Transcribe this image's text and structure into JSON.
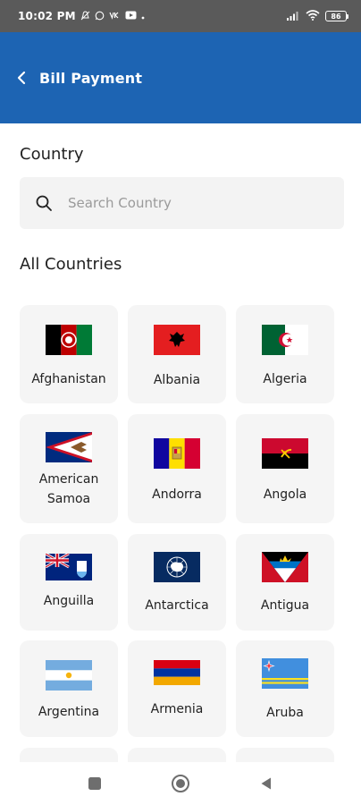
{
  "status_bar": {
    "time": "10:02 PM",
    "battery": "86"
  },
  "app_bar": {
    "title": "Bill Payment"
  },
  "country_section": {
    "label": "Country"
  },
  "search": {
    "placeholder": "Search Country",
    "value": ""
  },
  "all_countries": {
    "label": "All Countries",
    "items": [
      {
        "name": "Afghanistan",
        "flag": "afghanistan-flag"
      },
      {
        "name": "Albania",
        "flag": "albania-flag"
      },
      {
        "name": "Algeria",
        "flag": "algeria-flag"
      },
      {
        "name": "American Samoa",
        "flag": "american-samoa-flag"
      },
      {
        "name": "Andorra",
        "flag": "andorra-flag"
      },
      {
        "name": "Angola",
        "flag": "angola-flag"
      },
      {
        "name": "Anguilla",
        "flag": "anguilla-flag"
      },
      {
        "name": "Antarctica",
        "flag": "antarctica-flag"
      },
      {
        "name": "Antigua",
        "flag": "antigua-flag"
      },
      {
        "name": "Argentina",
        "flag": "argentina-flag"
      },
      {
        "name": "Armenia",
        "flag": "armenia-flag"
      },
      {
        "name": "Aruba",
        "flag": "aruba-flag"
      }
    ]
  },
  "colors": {
    "app_bar": "#1d64b3",
    "status_bar": "#5a5a5a",
    "card_bg": "#f5f5f5",
    "search_bg": "#f3f3f3"
  },
  "nav_bar": {
    "icons": [
      "recent-apps-icon",
      "home-icon",
      "back-icon"
    ]
  }
}
